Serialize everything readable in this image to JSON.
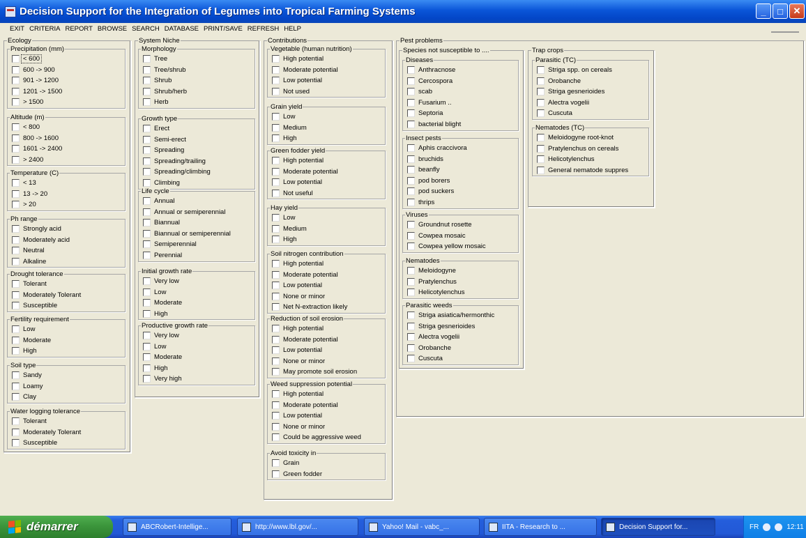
{
  "window": {
    "title": "Decision Support for the Integration of Legumes into Tropical Farming Systems",
    "min": "_",
    "max": "□",
    "close": "✕"
  },
  "menu": [
    "EXIT",
    "CRITERIA",
    "REPORT",
    "BROWSE",
    "SEARCH",
    "DATABASE",
    "PRINT/SAVE",
    "REFRESH",
    "HELP"
  ],
  "panels": {
    "ecology": "Ecology",
    "niche": "System Niche",
    "contributions": "Contributions",
    "pest": "Pest problems",
    "species": "Species not susceptible to ....",
    "trap": "Trap crops"
  },
  "ecology": {
    "precipitation": {
      "title": "Precipitation (mm)",
      "items": [
        "< 600",
        "600 -> 900",
        "901 -> 1200",
        "1201 -> 1500",
        "> 1500"
      ]
    },
    "altitude": {
      "title": "Altitude (m)",
      "items": [
        "< 800",
        "800 -> 1600",
        "1601 -> 2400",
        "> 2400"
      ]
    },
    "temperature": {
      "title": "Temperature (C)",
      "items": [
        "< 13",
        "13 -> 20",
        "> 20"
      ]
    },
    "ph": {
      "title": "Ph range",
      "items": [
        "Strongly acid",
        "Moderately acid",
        "Neutral",
        "Alkaline"
      ]
    },
    "drought": {
      "title": "Drought tolerance",
      "items": [
        "Tolerant",
        "Moderately Tolerant",
        "Susceptible"
      ]
    },
    "fertility": {
      "title": "Fertility requirement",
      "items": [
        "Low",
        "Moderate",
        "High"
      ]
    },
    "soil": {
      "title": "Soil type",
      "items": [
        "Sandy",
        "Loamy",
        "Clay"
      ]
    },
    "waterlog": {
      "title": "Water logging tolerance",
      "items": [
        "Tolerant",
        "Moderately Tolerant",
        "Susceptible"
      ]
    }
  },
  "niche": {
    "morphology": {
      "title": "Morphology",
      "items": [
        "Tree",
        "Tree/shrub",
        "Shrub",
        "Shrub/herb",
        "Herb"
      ]
    },
    "growth": {
      "title": "Growth type",
      "items": [
        "Erect",
        "Semi-erect",
        "Spreading",
        "Spreading/trailing",
        "Spreading/climbing",
        "Climbing"
      ]
    },
    "lifecycle": {
      "title": "Life cycle",
      "items": [
        "Annual",
        "Annual or semiperennial",
        "Biannual",
        "Biannual or semiperennial",
        "Semiperennial",
        "Perennial"
      ]
    },
    "initial": {
      "title": "Initial growth rate",
      "items": [
        "Very low",
        "Low",
        "Moderate",
        "High"
      ]
    },
    "productive": {
      "title": "Productive growth rate",
      "items": [
        "Very low",
        "Low",
        "Moderate",
        "High",
        "Very high"
      ]
    }
  },
  "contrib": {
    "vegetable": {
      "title": "Vegetable (human nutrition)",
      "items": [
        "High potential",
        "Moderate potential",
        "Low potential",
        "Not used"
      ]
    },
    "grain": {
      "title": "Grain yield",
      "items": [
        "Low",
        "Medium",
        "High"
      ]
    },
    "fodder": {
      "title": "Green fodder yield",
      "items": [
        "High potential",
        "Moderate potential",
        "Low potential",
        "Not useful"
      ]
    },
    "hay": {
      "title": "Hay yield",
      "items": [
        "Low",
        "Medium",
        "High"
      ]
    },
    "nitrogen": {
      "title": "Soil nitrogen contribution",
      "items": [
        "High potential",
        "Moderate potential",
        "Low potential",
        "None or minor",
        "Net N-extraction likely"
      ]
    },
    "erosion": {
      "title": "Reduction of soil erosion",
      "items": [
        "High potential",
        "Moderate potential",
        "Low potential",
        "None or minor",
        "May promote soil erosion"
      ]
    },
    "weed": {
      "title": "Weed suppression potential",
      "items": [
        "High potential",
        "Moderate potential",
        "Low potential",
        "None or minor",
        "Could be aggressive weed"
      ]
    },
    "toxicity": {
      "title": "Avoid toxicity in",
      "items": [
        "Grain",
        "Green fodder"
      ]
    }
  },
  "pest": {
    "diseases": {
      "title": "Diseases",
      "items": [
        "Anthracnose",
        "Cercospora",
        "scab",
        "Fusarium ..",
        "Septoria",
        "bacterial blight"
      ]
    },
    "insects": {
      "title": "Insect pests",
      "items": [
        "Aphis craccivora",
        "bruchids",
        "beanfly",
        "pod borers",
        "pod suckers",
        "thrips"
      ]
    },
    "viruses": {
      "title": "Viruses",
      "items": [
        "Groundnut rosette",
        "Cowpea mosaic",
        "Cowpea yellow mosaic"
      ]
    },
    "nematodes": {
      "title": "Nematodes",
      "items": [
        "Meloidogyne",
        "Pratylenchus",
        "Helicotylenchus"
      ]
    },
    "weeds": {
      "title": "Parasitic weeds",
      "items": [
        "Striga asiatica/hermonthic",
        "Striga gesnerioides",
        "Alectra vogelii",
        "Orobanche",
        "Cuscuta"
      ]
    }
  },
  "trap": {
    "parasitic": {
      "title": "Parasitic (TC)",
      "items": [
        "Striga spp. on cereals",
        "Orobanche",
        "Striga gesnerioides",
        "Alectra vogelii",
        "Cuscuta"
      ]
    },
    "nematodes": {
      "title": "Nematodes (TC)",
      "items": [
        "Meloidogyne root-knot",
        "Pratylenchus on cereals",
        "Helicotylenchus",
        "General nematode suppres"
      ]
    }
  },
  "taskbar": {
    "start": "démarrer",
    "tasks": [
      "ABCRobert-Intellige...",
      "http://www.lbl.gov/...",
      "Yahoo! Mail - vabc_...",
      "IITA - Research to ...",
      "Decision Support for..."
    ],
    "lang": "FR",
    "clock": "12:11"
  }
}
